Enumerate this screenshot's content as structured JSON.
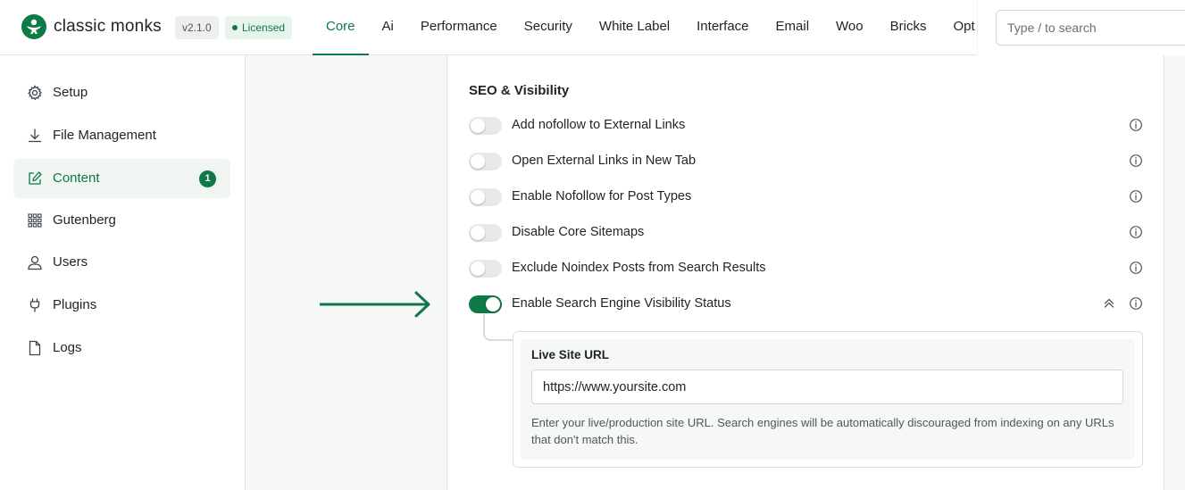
{
  "header": {
    "brand": "classic monks",
    "version": "v2.1.0",
    "license_status": "Licensed",
    "tabs": [
      {
        "label": "Core",
        "active": true
      },
      {
        "label": "Ai"
      },
      {
        "label": "Performance"
      },
      {
        "label": "Security"
      },
      {
        "label": "White Label"
      },
      {
        "label": "Interface"
      },
      {
        "label": "Email"
      },
      {
        "label": "Woo"
      },
      {
        "label": "Bricks"
      },
      {
        "label": "Opt"
      }
    ],
    "search": {
      "placeholder": "Type / to search"
    }
  },
  "sidebar": {
    "items": [
      {
        "label": "Setup",
        "icon": "gear-icon"
      },
      {
        "label": "File Management",
        "icon": "download-icon"
      },
      {
        "label": "Content",
        "icon": "edit-icon",
        "active": true,
        "badge": "1"
      },
      {
        "label": "Gutenberg",
        "icon": "grid-icon"
      },
      {
        "label": "Users",
        "icon": "user-icon"
      },
      {
        "label": "Plugins",
        "icon": "plug-icon"
      },
      {
        "label": "Logs",
        "icon": "file-icon"
      }
    ]
  },
  "section": {
    "title": "SEO & Visibility",
    "settings": [
      {
        "label": "Add nofollow to External Links",
        "enabled": false
      },
      {
        "label": "Open External Links in New Tab",
        "enabled": false
      },
      {
        "label": "Enable Nofollow for Post Types",
        "enabled": false
      },
      {
        "label": "Disable Core Sitemaps",
        "enabled": false
      },
      {
        "label": "Exclude Noindex Posts from Search Results",
        "enabled": false
      },
      {
        "label": "Enable Search Engine Visibility Status",
        "enabled": true,
        "expanded": true
      }
    ],
    "subsetting": {
      "label": "Live Site URL",
      "value": "https://www.yoursite.com",
      "help": "Enter your live/production site URL. Search engines will be automatically discouraged from indexing on any URLs that don't match this."
    }
  },
  "colors": {
    "accent": "#0e7a47",
    "toggle_off": "#e6e8ea",
    "text": "#1d2327",
    "muted": "#50575e"
  }
}
